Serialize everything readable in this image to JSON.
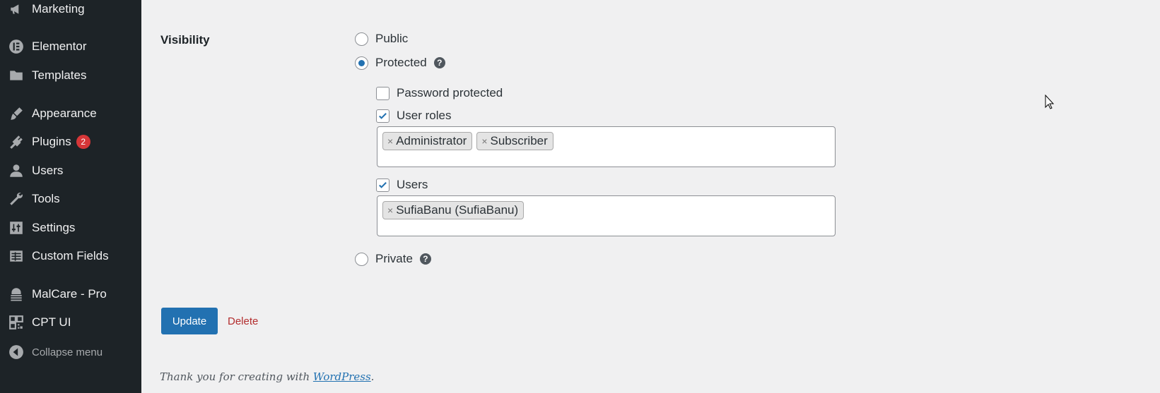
{
  "sidebar": {
    "items": [
      {
        "label": "Marketing",
        "icon": "megaphone-icon"
      },
      {
        "label": "Elementor",
        "icon": "elementor-icon"
      },
      {
        "label": "Templates",
        "icon": "folder-icon"
      },
      {
        "label": "Appearance",
        "icon": "paintbrush-icon"
      },
      {
        "label": "Plugins",
        "icon": "plugin-icon",
        "badge": "2"
      },
      {
        "label": "Users",
        "icon": "user-icon"
      },
      {
        "label": "Tools",
        "icon": "wrench-icon"
      },
      {
        "label": "Settings",
        "icon": "sliders-icon"
      },
      {
        "label": "Custom Fields",
        "icon": "grid-icon"
      },
      {
        "label": "MalCare - Pro",
        "icon": "malcare-icon"
      },
      {
        "label": "CPT UI",
        "icon": "cpt-icon"
      }
    ],
    "collapse_label": "Collapse menu"
  },
  "visibility": {
    "label": "Visibility",
    "options": {
      "public": "Public",
      "protected": "Protected",
      "private": "Private"
    },
    "selected": "protected",
    "protected_options": {
      "password_protected": "Password protected",
      "user_roles": "User roles",
      "users": "Users"
    },
    "user_roles_tags": [
      "Administrator",
      "Subscriber"
    ],
    "users_tags": [
      "SufiaBanu (SufiaBanu)"
    ]
  },
  "actions": {
    "update_label": "Update",
    "delete_label": "Delete"
  },
  "footer": {
    "text": "Thank you for creating with ",
    "link": "WordPress",
    "suffix": "."
  },
  "colors": {
    "sidebar_bg": "#1d2327",
    "accent": "#2271b1",
    "delete": "#b32d2e",
    "badge": "#d63638"
  }
}
